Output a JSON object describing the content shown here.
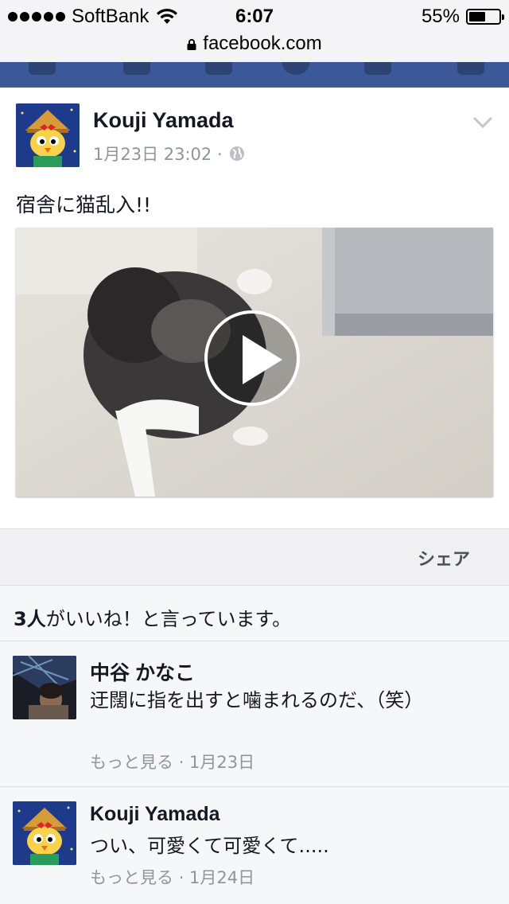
{
  "status_bar": {
    "carrier": "SoftBank",
    "time": "6:07",
    "battery_percent": "55%",
    "battery_level": 0.55
  },
  "url_bar": {
    "domain": "facebook.com"
  },
  "post": {
    "author": "Kouji Yamada",
    "timestamp": "1月23日 23:02 ·",
    "text": "宿舎に猫乱入!!",
    "icons": {
      "privacy": "globe-icon",
      "menu": "chevron-down-icon",
      "video": "play-icon"
    }
  },
  "share_bar": {
    "share_label": "シェア"
  },
  "likes": {
    "count": "3人",
    "suffix": "がいいね！と言っています。"
  },
  "comments": [
    {
      "author": "中谷 かなこ",
      "text": "迂闊に指を出すと噛まれるのだ、（笑）",
      "see_more": "もっと見る",
      "date": "· 1月23日"
    },
    {
      "author": "Kouji Yamada",
      "text": "つい、可愛くて可愛くて.....",
      "see_more": "もっと見る",
      "date": "· 1月24日"
    }
  ],
  "colors": {
    "facebook_blue": "#3b5998",
    "text_primary": "#141823",
    "text_secondary": "#90949c"
  }
}
